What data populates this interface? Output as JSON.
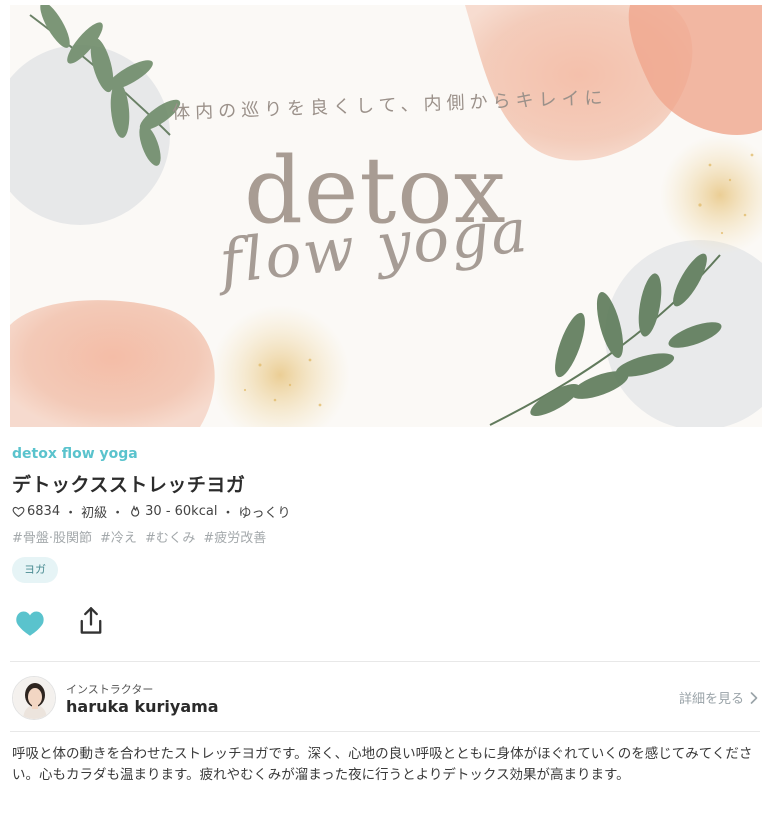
{
  "hero": {
    "tagline": "体内の巡りを良くして、内側からキレイに",
    "title": "detox",
    "subtitle": "flow yoga"
  },
  "lesson": {
    "brand": "detox flow yoga",
    "title": "デトックスストレッチヨガ",
    "likes": "6834",
    "level": "初級",
    "calories": "30 - 60kcal",
    "pace": "ゆっくり",
    "separator": "・",
    "tags": [
      "#骨盤·股関節",
      "#冷え",
      "#むくみ",
      "#疲労改善"
    ],
    "category": "ヨガ"
  },
  "actions": {
    "like_icon": "heart-icon",
    "share_icon": "share-icon",
    "like_color": "#5ac3cd"
  },
  "instructor": {
    "role": "インストラクター",
    "name": "haruka kuriyama",
    "details_link": "詳細を見る"
  },
  "description": "呼吸と体の動きを合わせたストレッチヨガです。深く、心地の良い呼吸とともに身体がほぐれていくのを感じてみてください。心もカラダも温まります。疲れやむくみが溜まった夜に行うとよりデトックス効果が高まります。",
  "colors": {
    "accent": "#5ac3cd",
    "tag": "#a3a8ab",
    "chip_bg": "#e6f4f6"
  }
}
